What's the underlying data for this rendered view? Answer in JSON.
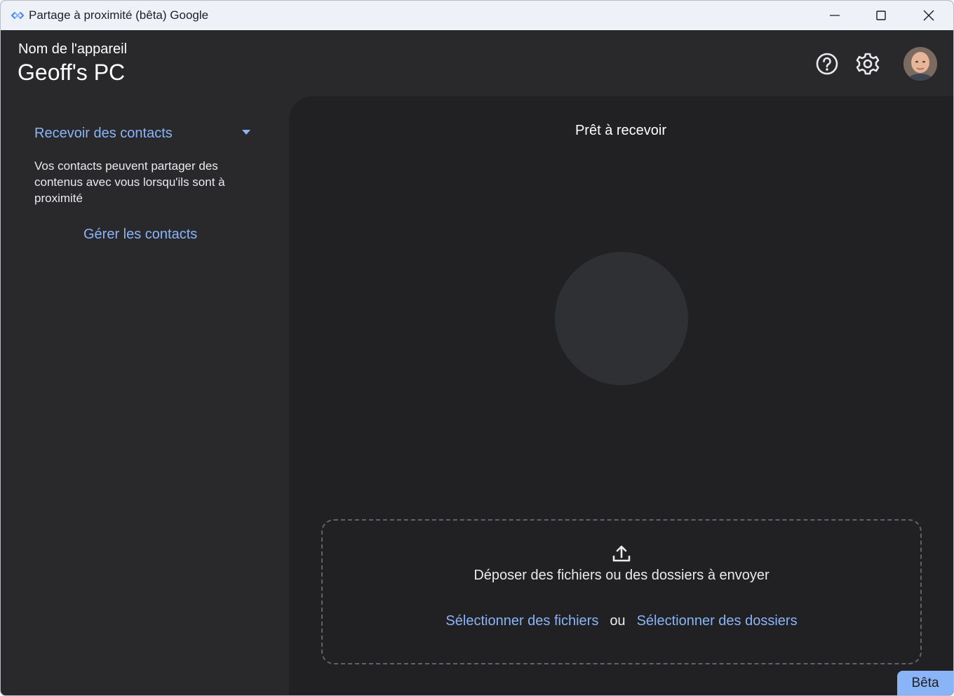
{
  "window": {
    "title": "Partage à proximité (bêta) Google",
    "controls": {
      "minimize": "minimize-icon",
      "maximize": "maximize-icon",
      "close": "close-icon"
    }
  },
  "header": {
    "device_label": "Nom de l'appareil",
    "device_name": "Geoff's PC",
    "icons": {
      "help": "help-circle-icon",
      "settings": "gear-icon",
      "avatar": "user-avatar"
    }
  },
  "sidebar": {
    "visibility_label": "Recevoir des contacts",
    "visibility_description": "Vos contacts peuvent partager des contenus avec vous lorsqu'ils sont à proximité",
    "manage_contacts": "Gérer les contacts"
  },
  "main": {
    "status": "Prêt à recevoir",
    "drop_text": "Déposer des fichiers ou des dossiers à envoyer",
    "select_files": "Sélectionner des fichiers",
    "or": "ou",
    "select_folders": "Sélectionner des dossiers"
  },
  "badge": {
    "beta": "Bêta"
  },
  "colors": {
    "accent": "#8ab4f8",
    "background": "#29292c",
    "panel": "#212123"
  }
}
